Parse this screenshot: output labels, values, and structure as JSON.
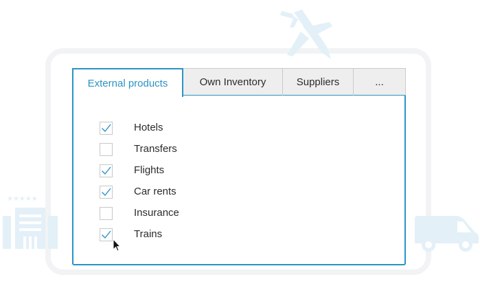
{
  "tabs": [
    {
      "label": "External products",
      "active": true
    },
    {
      "label": "Own Inventory",
      "active": false
    },
    {
      "label": "Suppliers",
      "active": false
    },
    {
      "label": "...",
      "active": false
    }
  ],
  "options": [
    {
      "label": "Hotels",
      "checked": true
    },
    {
      "label": "Transfers",
      "checked": false
    },
    {
      "label": "Flights",
      "checked": true
    },
    {
      "label": "Car rents",
      "checked": true
    },
    {
      "label": "Insurance",
      "checked": false
    },
    {
      "label": "Trains",
      "checked": true
    }
  ],
  "colors": {
    "accent": "#2a93c4",
    "decor": "#e3f0f8",
    "frame": "#f2f3f4"
  },
  "decorations": [
    "airplane-icon",
    "hotel-building-icon",
    "van-icon",
    "mouse-cursor-icon"
  ]
}
